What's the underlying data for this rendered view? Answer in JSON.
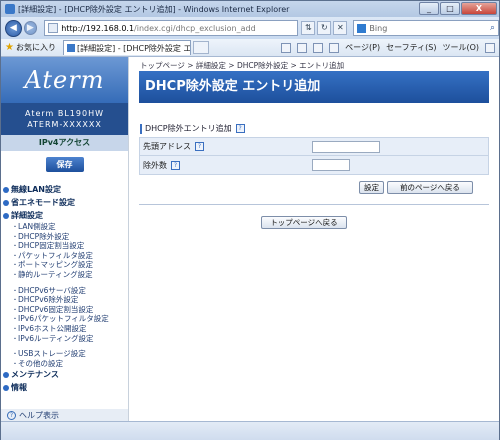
{
  "window": {
    "title": "[詳細設定] - [DHCP除外設定 エントリ追加] - Windows Internet Explorer",
    "min": "_",
    "max": "□",
    "close": "X"
  },
  "browser": {
    "url_host": "http://192.168.0.1",
    "url_path": "/index.cgi/dhcp_exclusion_add",
    "search_placeholder": "Bing",
    "favorites_label": "お気に入り",
    "tab_label": "[詳細設定] - [DHCP除外設定 エント...",
    "commands": [
      "ページ(P)",
      "セーフティ(S)",
      "ツール(O)"
    ]
  },
  "sidebar": {
    "logo": "Aterm",
    "model_line1": "Aterm BL190HW",
    "model_line2": "ATERM-XXXXXX",
    "mode": "IPv4アクセス",
    "save_label": "保存",
    "sections": [
      {
        "label": "無線LAN設定"
      },
      {
        "label": "省エネモード設定"
      },
      {
        "label": "詳細設定"
      }
    ],
    "detail_items_group1": [
      "LAN側設定",
      "DHCP除外設定",
      "DHCP固定割当設定",
      "パケットフィルタ設定",
      "ポートマッピング設定",
      "静的ルーティング設定"
    ],
    "detail_items_group2": [
      "DHCPv6サーバ設定",
      "DHCPv6除外設定",
      "DHCPv6固定割当設定",
      "IPv6パケットフィルタ設定",
      "IPv6ホスト公開設定",
      "IPv6ルーティング設定"
    ],
    "detail_items_group3": [
      "USBストレージ設定",
      "その他の設定"
    ],
    "maintenance": "メンテナンス",
    "info": "情報",
    "help": "ヘルプ表示"
  },
  "main": {
    "breadcrumb": "トップページ > 詳細設定 > DHCP除外設定 > エントリ追加",
    "title": "DHCP除外設定 エントリ追加",
    "section_title": "DHCP除外エントリ追加",
    "fields": [
      {
        "label": "先頭アドレス",
        "value": ""
      },
      {
        "label": "除外数",
        "value": ""
      }
    ],
    "set_button": "設定",
    "back_button": "前のページへ戻る",
    "top_button": "トップページへ戻る"
  }
}
